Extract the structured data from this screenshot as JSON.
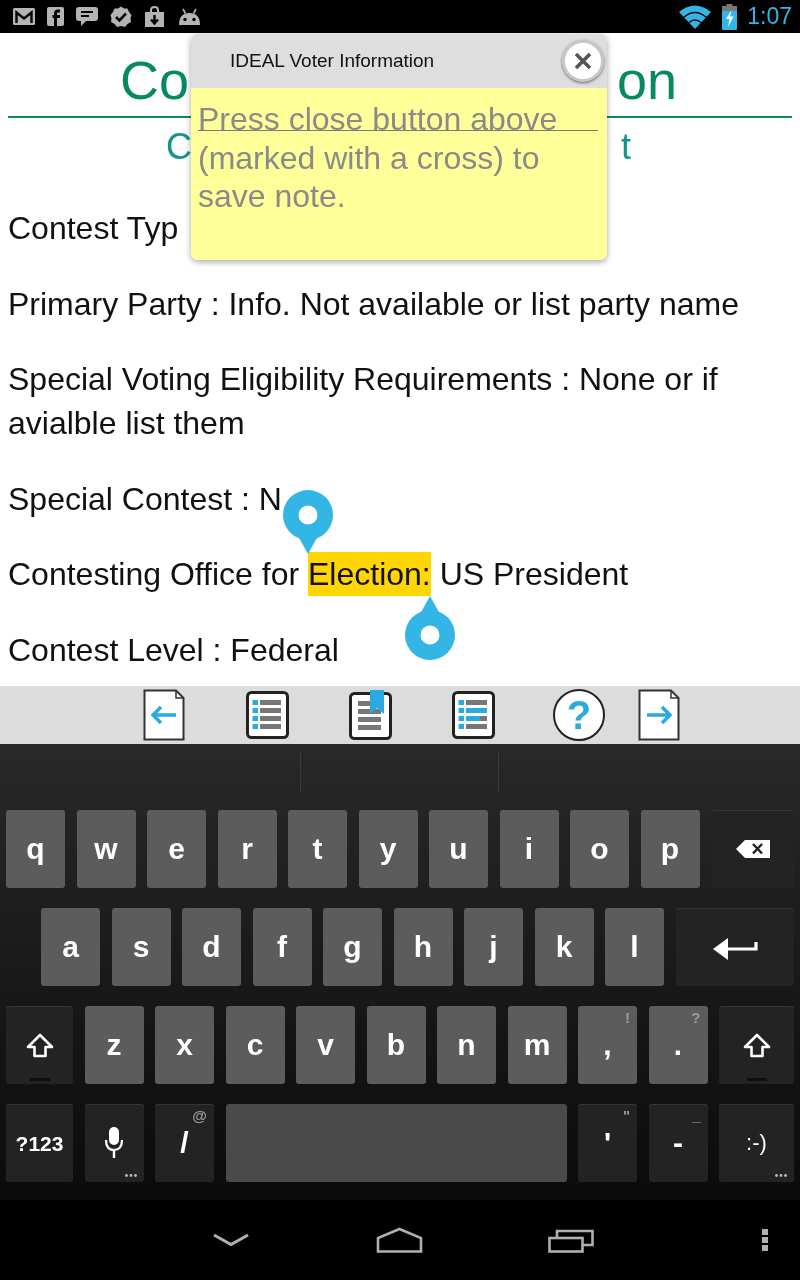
{
  "status_bar": {
    "time": "1:07"
  },
  "document": {
    "title": {
      "left": "Co",
      "right": "on"
    },
    "subtitle": {
      "left": "C",
      "right": "t"
    },
    "lines": [
      {
        "parts": [
          {
            "text": "Contest Typ",
            "selected": false
          }
        ]
      },
      {
        "parts": [
          {
            "text": "Primary Party : Info. Not available or list party name",
            "selected": false
          }
        ]
      },
      {
        "parts": [
          {
            "text": "Special Voting Eligibility Requirements : None or if avialble list them",
            "selected": false
          }
        ]
      },
      {
        "parts": [
          {
            "text": "Special Contest : N",
            "selected": false
          }
        ]
      },
      {
        "parts": [
          {
            "text": "Contesting Office for",
            "selected": false
          },
          {
            "text": "Election:",
            "selected": true
          },
          {
            "text": "US President",
            "selected": false
          }
        ]
      },
      {
        "parts": [
          {
            "text": "Contest Level : Federal",
            "selected": false
          }
        ]
      }
    ]
  },
  "note_popup": {
    "title": "IDEAL Voter Information",
    "note": {
      "placeholder": "Press close button above (marked with a cross) to save note."
    }
  },
  "toolbar": {
    "buttons": [
      {
        "kind": "previous"
      },
      {
        "kind": "contents"
      },
      {
        "kind": "bookmark"
      },
      {
        "kind": "list"
      },
      {
        "kind": "help",
        "label": "?"
      },
      {
        "kind": "next"
      }
    ]
  },
  "keyboard": {
    "rows": [
      [
        {
          "kind": "letter",
          "label": "q",
          "more": false
        },
        {
          "kind": "letter",
          "label": "w",
          "more": false
        },
        {
          "kind": "letter",
          "label": "e",
          "more": false
        },
        {
          "kind": "letter",
          "label": "r",
          "more": false
        },
        {
          "kind": "letter",
          "label": "t",
          "more": false
        },
        {
          "kind": "letter",
          "label": "y",
          "more": false
        },
        {
          "kind": "letter",
          "label": "u",
          "more": false
        },
        {
          "kind": "letter",
          "label": "i",
          "more": false
        },
        {
          "kind": "letter",
          "label": "o",
          "more": false
        },
        {
          "kind": "letter",
          "label": "p",
          "more": false
        },
        {
          "kind": "backspace",
          "more": false
        }
      ],
      [
        {
          "kind": "letter",
          "label": "a",
          "more": false
        },
        {
          "kind": "letter",
          "label": "s",
          "more": false
        },
        {
          "kind": "letter",
          "label": "d",
          "more": false
        },
        {
          "kind": "letter",
          "label": "f",
          "more": false
        },
        {
          "kind": "letter",
          "label": "g",
          "more": false
        },
        {
          "kind": "letter",
          "label": "h",
          "more": false
        },
        {
          "kind": "letter",
          "label": "j",
          "more": false
        },
        {
          "kind": "letter",
          "label": "k",
          "more": false
        },
        {
          "kind": "letter",
          "label": "l",
          "more": false
        },
        {
          "kind": "enter",
          "more": false
        }
      ],
      [
        {
          "kind": "shift",
          "more": false
        },
        {
          "kind": "letter",
          "label": "z",
          "more": false
        },
        {
          "kind": "letter",
          "label": "x",
          "more": false
        },
        {
          "kind": "letter",
          "label": "c",
          "more": false
        },
        {
          "kind": "letter",
          "label": "v",
          "more": false
        },
        {
          "kind": "letter",
          "label": "b",
          "more": false
        },
        {
          "kind": "letter",
          "label": "n",
          "more": false
        },
        {
          "kind": "letter",
          "label": "m",
          "more": false
        },
        {
          "kind": "letter",
          "label": ",",
          "hint": "!",
          "more": false
        },
        {
          "kind": "letter",
          "label": ".",
          "hint": "?",
          "more": false
        },
        {
          "kind": "shift",
          "more": false
        }
      ],
      [
        {
          "kind": "mode",
          "label": "?123",
          "more": false
        },
        {
          "kind": "mic",
          "more": true
        },
        {
          "kind": "symbol",
          "label": "/",
          "hint": "@",
          "more": false
        },
        {
          "kind": "space",
          "more": false
        },
        {
          "kind": "symbol",
          "label": "'",
          "hint": "\"",
          "more": false
        },
        {
          "kind": "symbol",
          "label": "-",
          "hint": "_",
          "more": false
        },
        {
          "kind": "smiley",
          "label": ":-)",
          "more": true
        }
      ]
    ]
  }
}
